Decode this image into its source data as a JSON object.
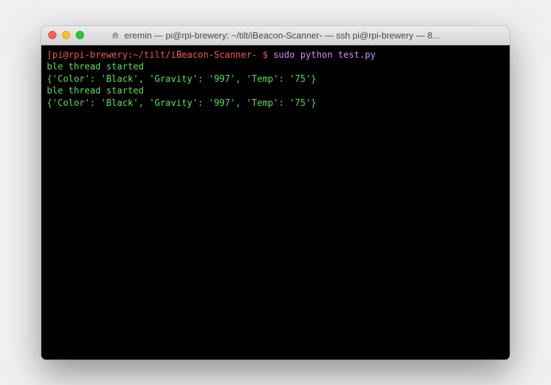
{
  "titlebar": {
    "title": "eremin — pi@rpi-brewery: ~/tilt/iBeacon-Scanner- — ssh pi@rpi-brewery — 8..."
  },
  "terminal": {
    "prompt": "[pi@rpi-brewery:~/tilt/iBeacon-Scanner- $ ",
    "command": "sudo python test.py",
    "output_lines": [
      "ble thread started",
      "{'Color': 'Black', 'Gravity': '997', 'Temp': '75'}",
      "ble thread started",
      "{'Color': 'Black', 'Gravity': '997', 'Temp': '75'}"
    ]
  }
}
